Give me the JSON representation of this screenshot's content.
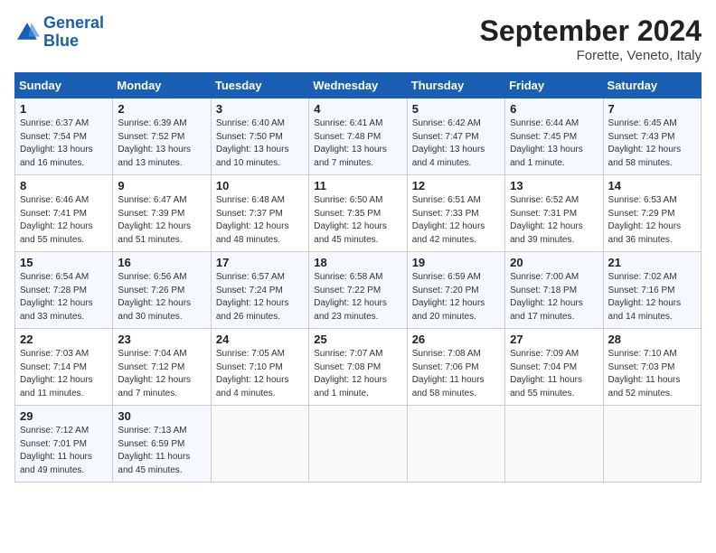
{
  "header": {
    "logo_line1": "General",
    "logo_line2": "Blue",
    "month_title": "September 2024",
    "location": "Forette, Veneto, Italy"
  },
  "weekdays": [
    "Sunday",
    "Monday",
    "Tuesday",
    "Wednesday",
    "Thursday",
    "Friday",
    "Saturday"
  ],
  "weeks": [
    [
      {
        "day": "1",
        "info": "Sunrise: 6:37 AM\nSunset: 7:54 PM\nDaylight: 13 hours\nand 16 minutes."
      },
      {
        "day": "2",
        "info": "Sunrise: 6:39 AM\nSunset: 7:52 PM\nDaylight: 13 hours\nand 13 minutes."
      },
      {
        "day": "3",
        "info": "Sunrise: 6:40 AM\nSunset: 7:50 PM\nDaylight: 13 hours\nand 10 minutes."
      },
      {
        "day": "4",
        "info": "Sunrise: 6:41 AM\nSunset: 7:48 PM\nDaylight: 13 hours\nand 7 minutes."
      },
      {
        "day": "5",
        "info": "Sunrise: 6:42 AM\nSunset: 7:47 PM\nDaylight: 13 hours\nand 4 minutes."
      },
      {
        "day": "6",
        "info": "Sunrise: 6:44 AM\nSunset: 7:45 PM\nDaylight: 13 hours\nand 1 minute."
      },
      {
        "day": "7",
        "info": "Sunrise: 6:45 AM\nSunset: 7:43 PM\nDaylight: 12 hours\nand 58 minutes."
      }
    ],
    [
      {
        "day": "8",
        "info": "Sunrise: 6:46 AM\nSunset: 7:41 PM\nDaylight: 12 hours\nand 55 minutes."
      },
      {
        "day": "9",
        "info": "Sunrise: 6:47 AM\nSunset: 7:39 PM\nDaylight: 12 hours\nand 51 minutes."
      },
      {
        "day": "10",
        "info": "Sunrise: 6:48 AM\nSunset: 7:37 PM\nDaylight: 12 hours\nand 48 minutes."
      },
      {
        "day": "11",
        "info": "Sunrise: 6:50 AM\nSunset: 7:35 PM\nDaylight: 12 hours\nand 45 minutes."
      },
      {
        "day": "12",
        "info": "Sunrise: 6:51 AM\nSunset: 7:33 PM\nDaylight: 12 hours\nand 42 minutes."
      },
      {
        "day": "13",
        "info": "Sunrise: 6:52 AM\nSunset: 7:31 PM\nDaylight: 12 hours\nand 39 minutes."
      },
      {
        "day": "14",
        "info": "Sunrise: 6:53 AM\nSunset: 7:29 PM\nDaylight: 12 hours\nand 36 minutes."
      }
    ],
    [
      {
        "day": "15",
        "info": "Sunrise: 6:54 AM\nSunset: 7:28 PM\nDaylight: 12 hours\nand 33 minutes."
      },
      {
        "day": "16",
        "info": "Sunrise: 6:56 AM\nSunset: 7:26 PM\nDaylight: 12 hours\nand 30 minutes."
      },
      {
        "day": "17",
        "info": "Sunrise: 6:57 AM\nSunset: 7:24 PM\nDaylight: 12 hours\nand 26 minutes."
      },
      {
        "day": "18",
        "info": "Sunrise: 6:58 AM\nSunset: 7:22 PM\nDaylight: 12 hours\nand 23 minutes."
      },
      {
        "day": "19",
        "info": "Sunrise: 6:59 AM\nSunset: 7:20 PM\nDaylight: 12 hours\nand 20 minutes."
      },
      {
        "day": "20",
        "info": "Sunrise: 7:00 AM\nSunset: 7:18 PM\nDaylight: 12 hours\nand 17 minutes."
      },
      {
        "day": "21",
        "info": "Sunrise: 7:02 AM\nSunset: 7:16 PM\nDaylight: 12 hours\nand 14 minutes."
      }
    ],
    [
      {
        "day": "22",
        "info": "Sunrise: 7:03 AM\nSunset: 7:14 PM\nDaylight: 12 hours\nand 11 minutes."
      },
      {
        "day": "23",
        "info": "Sunrise: 7:04 AM\nSunset: 7:12 PM\nDaylight: 12 hours\nand 7 minutes."
      },
      {
        "day": "24",
        "info": "Sunrise: 7:05 AM\nSunset: 7:10 PM\nDaylight: 12 hours\nand 4 minutes."
      },
      {
        "day": "25",
        "info": "Sunrise: 7:07 AM\nSunset: 7:08 PM\nDaylight: 12 hours\nand 1 minute."
      },
      {
        "day": "26",
        "info": "Sunrise: 7:08 AM\nSunset: 7:06 PM\nDaylight: 11 hours\nand 58 minutes."
      },
      {
        "day": "27",
        "info": "Sunrise: 7:09 AM\nSunset: 7:04 PM\nDaylight: 11 hours\nand 55 minutes."
      },
      {
        "day": "28",
        "info": "Sunrise: 7:10 AM\nSunset: 7:03 PM\nDaylight: 11 hours\nand 52 minutes."
      }
    ],
    [
      {
        "day": "29",
        "info": "Sunrise: 7:12 AM\nSunset: 7:01 PM\nDaylight: 11 hours\nand 49 minutes."
      },
      {
        "day": "30",
        "info": "Sunrise: 7:13 AM\nSunset: 6:59 PM\nDaylight: 11 hours\nand 45 minutes."
      },
      null,
      null,
      null,
      null,
      null
    ]
  ]
}
